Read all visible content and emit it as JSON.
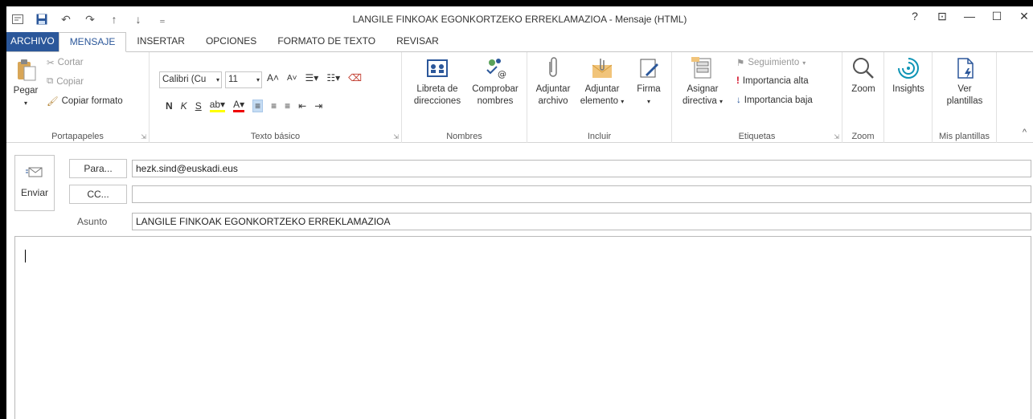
{
  "window": {
    "title": "LANGILE FINKOAK EGONKORTZEKO ERREKLAMAZIOA - Mensaje (HTML)",
    "controls": {
      "help": "?",
      "ribbon_options": "⊡",
      "minimize": "—",
      "maximize": "☐",
      "close": "✕"
    }
  },
  "quick_access": [
    "outlook-icon",
    "save-icon",
    "undo-icon",
    "redo-icon",
    "up-icon",
    "down-icon",
    "customize-icon"
  ],
  "tabs": [
    "ARCHIVO",
    "MENSAJE",
    "INSERTAR",
    "OPCIONES",
    "FORMATO DE TEXTO",
    "REVISAR"
  ],
  "active_tab": "MENSAJE",
  "ribbon": {
    "clipboard": {
      "label": "Portapapeles",
      "paste": "Pegar",
      "cut": "Cortar",
      "copy": "Copiar",
      "format_painter": "Copiar formato"
    },
    "basic_text": {
      "label": "Texto básico",
      "font_name": "Calibri (Cu",
      "font_size": "11",
      "bold": "N",
      "italic": "K",
      "underline": "S"
    },
    "names": {
      "label": "Nombres",
      "address_book_line1": "Libreta de",
      "address_book_line2": "direcciones",
      "check_names_line1": "Comprobar",
      "check_names_line2": "nombres"
    },
    "include": {
      "label": "Incluir",
      "attach_file_line1": "Adjuntar",
      "attach_file_line2": "archivo",
      "attach_item_line1": "Adjuntar",
      "attach_item_line2": "elemento",
      "signature": "Firma"
    },
    "tags": {
      "label": "Etiquetas",
      "assign_policy_line1": "Asignar",
      "assign_policy_line2": "directiva",
      "follow_up": "Seguimiento",
      "high_importance": "Importancia alta",
      "low_importance": "Importancia baja"
    },
    "zoom": {
      "label": "Zoom",
      "button": "Zoom"
    },
    "insights": {
      "button": "Insights"
    },
    "templates": {
      "label": "Mis plantillas",
      "line1": "Ver",
      "line2": "plantillas"
    }
  },
  "header": {
    "send": "Enviar",
    "to_button": "Para...",
    "cc_button": "CC...",
    "subject_label": "Asunto",
    "to_value": "hezk.sind@euskadi.eus",
    "cc_value": "",
    "subject_value": "LANGILE FINKOAK EGONKORTZEKO ERREKLAMAZIOA"
  },
  "colors": {
    "accent": "#2b579a",
    "border": "#c6c6c6"
  }
}
